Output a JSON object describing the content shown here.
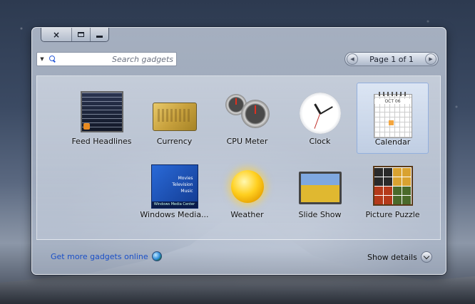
{
  "window": {
    "caption_buttons": {
      "close": "×"
    }
  },
  "search": {
    "placeholder": "Search gadgets",
    "value": ""
  },
  "pager": {
    "text": "Page 1 of 1"
  },
  "gadgets": [
    {
      "name": "Calendar",
      "icon": "calendar-icon",
      "month": "OCT 06",
      "selected": true
    },
    {
      "name": "Clock",
      "icon": "clock-icon"
    },
    {
      "name": "CPU Meter",
      "icon": "cpu-meter-icon"
    },
    {
      "name": "Currency",
      "icon": "currency-icon"
    },
    {
      "name": "Feed Headlines",
      "icon": "feed-headlines-icon"
    },
    {
      "name": "Picture Puzzle",
      "icon": "picture-puzzle-icon"
    },
    {
      "name": "Slide Show",
      "icon": "slide-show-icon"
    },
    {
      "name": "Weather",
      "icon": "weather-icon"
    },
    {
      "name": "Windows Media...",
      "icon": "windows-media-center-icon",
      "menu": [
        "Movies",
        "Television",
        "Music"
      ],
      "bar": "Windows Media Center"
    }
  ],
  "footer": {
    "show_details": "Show details",
    "get_more": "Get more gadgets online"
  },
  "colors": {
    "link": "#1a4fc8",
    "selection": "#c4d6f0"
  }
}
